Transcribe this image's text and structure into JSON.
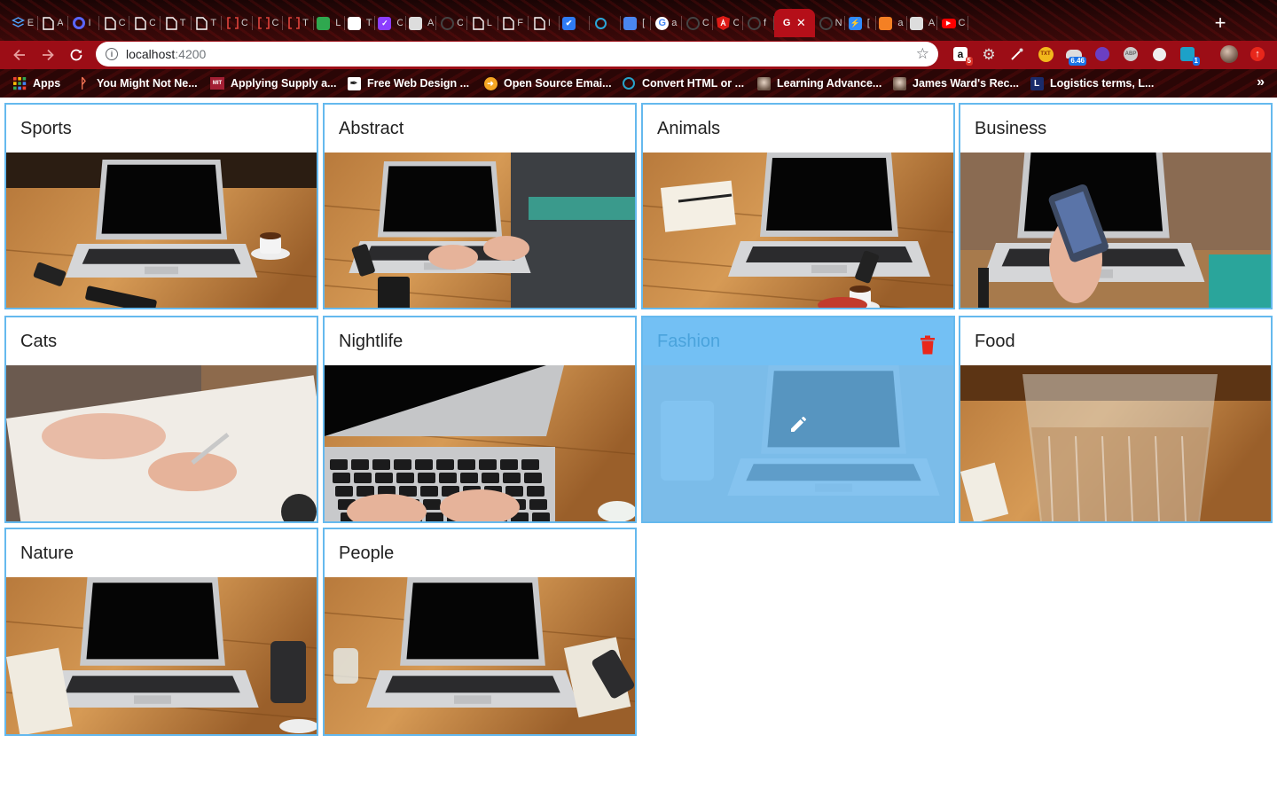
{
  "browser": {
    "tabs": [
      {
        "icon": "layers-icon",
        "char": "E",
        "color": "#4fa3ff"
      },
      {
        "icon": "document-icon",
        "char": "A",
        "color": "#ffffff"
      },
      {
        "icon": "circle-icon",
        "char": "I",
        "color": "#5a66ff"
      },
      {
        "icon": "document-icon",
        "char": "C",
        "color": "#ffffff"
      },
      {
        "icon": "document-icon",
        "char": "C",
        "color": "#ffffff"
      },
      {
        "icon": "document-icon",
        "char": "T",
        "color": "#ffffff"
      },
      {
        "icon": "document-icon",
        "char": "T",
        "color": "#ffffff"
      },
      {
        "icon": "bracket-icon",
        "char": "C",
        "color": "#e0443c"
      },
      {
        "icon": "bracket-icon",
        "char": "C",
        "color": "#e0443c"
      },
      {
        "icon": "bracket-icon",
        "char": "T",
        "color": "#e0443c"
      },
      {
        "icon": "angular-green-icon",
        "char": "L",
        "color": "#2fa84f"
      },
      {
        "icon": "dice-icon",
        "char": "T",
        "color": "#ffffff"
      },
      {
        "icon": "check-circle-icon",
        "char": "C",
        "color": "#8b3dff"
      },
      {
        "icon": "portrait-icon",
        "char": "A",
        "color": "#dddddd"
      },
      {
        "icon": "github-icon",
        "char": "C",
        "color": "#222222"
      },
      {
        "icon": "document-icon",
        "char": "L",
        "color": "#ffffff"
      },
      {
        "icon": "document-icon",
        "char": "F",
        "color": "#ffffff"
      },
      {
        "icon": "document-icon",
        "char": "I",
        "color": "#ffffff"
      },
      {
        "icon": "checkbox-icon",
        "char": "",
        "color": "#2f7bf5"
      },
      {
        "icon": "globe-icon",
        "char": "",
        "color": "#2aa6d8"
      },
      {
        "icon": "docs-icon",
        "char": "[",
        "color": "#4a86f0"
      },
      {
        "icon": "google-icon",
        "char": "a",
        "color": "#ffffff"
      },
      {
        "icon": "github-icon",
        "char": "C",
        "color": "#222222"
      },
      {
        "icon": "angular-icon",
        "char": "C",
        "color": "#dd1b16"
      },
      {
        "icon": "github-icon",
        "char": "f",
        "color": "#222222"
      }
    ],
    "active_tab": {
      "icon": "angular-g-icon",
      "char": "G",
      "close": "✕"
    },
    "tabs_after": [
      {
        "icon": "github-icon",
        "char": "N",
        "color": "#222222"
      },
      {
        "icon": "bolt-icon",
        "char": "[",
        "color": "#2f8bff"
      },
      {
        "icon": "stack-icon",
        "char": "a",
        "color": "#f48024"
      },
      {
        "icon": "brush-icon",
        "char": "A",
        "color": "#dddddd"
      },
      {
        "icon": "youtube-icon",
        "char": "C",
        "color": "#ff0000"
      }
    ],
    "url_host": "localhost",
    "url_port": ":4200",
    "extensions": [
      {
        "icon": "amazon-icon",
        "badge": "5",
        "badge_color": "#d93025"
      },
      {
        "icon": "gear-icon",
        "badge": "",
        "badge_color": ""
      },
      {
        "icon": "eyedropper-icon",
        "badge": "",
        "badge_color": ""
      },
      {
        "icon": "txt-icon",
        "badge": "",
        "badge_color": ""
      },
      {
        "icon": "cloud-icon",
        "badge": "6.46",
        "badge_color": "#1a73e8"
      },
      {
        "icon": "wappalyzer-icon",
        "badge": "",
        "badge_color": ""
      },
      {
        "icon": "abp-icon",
        "badge": "",
        "badge_color": ""
      },
      {
        "icon": "circle-light-icon",
        "badge": "",
        "badge_color": ""
      },
      {
        "icon": "trello-icon",
        "badge": "1",
        "badge_color": "#1a73e8"
      }
    ],
    "bookmarks": [
      {
        "icon": "apps-grid-icon",
        "label": "Apps"
      },
      {
        "icon": "hubspot-icon",
        "label": "You Might Not Ne..."
      },
      {
        "icon": "mit-icon",
        "label": "Applying Supply a..."
      },
      {
        "icon": "pen-icon",
        "label": "Free Web Design ..."
      },
      {
        "icon": "postal-icon",
        "label": "Open Source Emai..."
      },
      {
        "icon": "convert-icon",
        "label": "Convert HTML or ..."
      },
      {
        "icon": "portrait-icon",
        "label": "Learning Advance..."
      },
      {
        "icon": "portrait-icon",
        "label": "James Ward's Rec..."
      },
      {
        "icon": "l-icon",
        "label": "Logistics terms, L..."
      }
    ],
    "bookmarks_more": "»"
  },
  "gallery": {
    "cards": [
      {
        "title": "Sports",
        "image": "laptop-cafe-table-photo"
      },
      {
        "title": "Abstract",
        "image": "typing-laptop-photo"
      },
      {
        "title": "Animals",
        "image": "laptop-notebook-photo"
      },
      {
        "title": "Business",
        "image": "phone-laptop-photo"
      },
      {
        "title": "Cats",
        "image": "writing-hands-photo"
      },
      {
        "title": "Nightlife",
        "image": "keyboard-typing-photo"
      },
      {
        "title": "Fashion",
        "image": "laptop-glass-photo",
        "hovered": true
      },
      {
        "title": "Food",
        "image": "water-glass-photo"
      },
      {
        "title": "Nature",
        "image": "laptop-phone-desk-photo"
      },
      {
        "title": "People",
        "image": "laptop-wood-desk-photo"
      }
    ],
    "accent_color": "#65b9ee",
    "delete_color": "#e8271b"
  }
}
